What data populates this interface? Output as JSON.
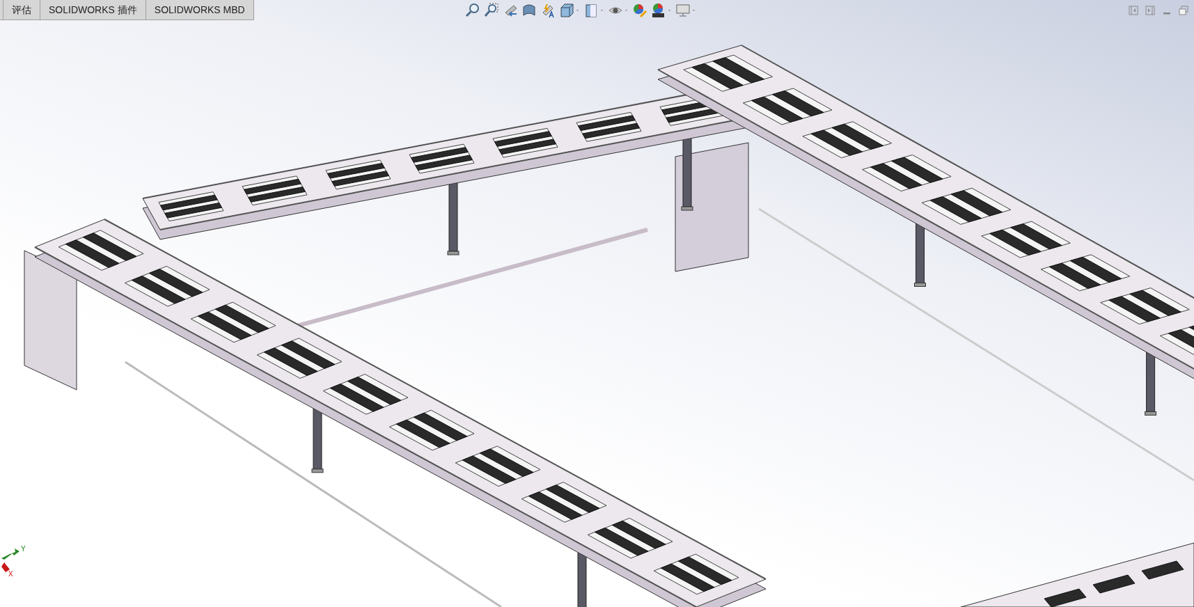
{
  "tabs": [
    {
      "label": "评估"
    },
    {
      "label": "SOLIDWORKS 插件"
    },
    {
      "label": "SOLIDWORKS MBD"
    }
  ],
  "triad": {
    "y_label": "Y",
    "x_label": "X"
  }
}
